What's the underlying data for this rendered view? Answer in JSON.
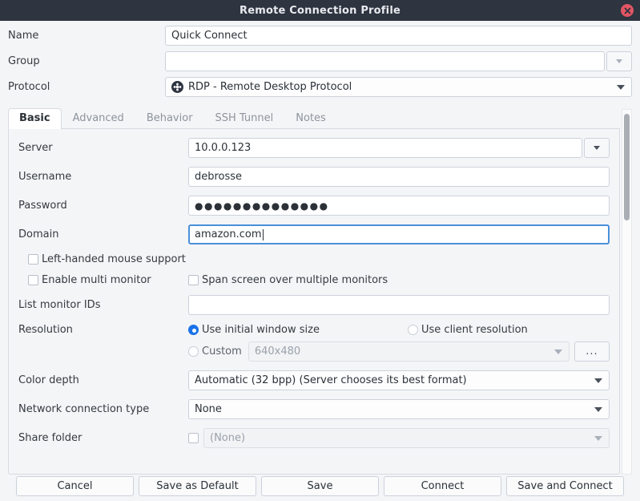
{
  "window": {
    "title": "Remote Connection Profile",
    "close_icon": "close-icon"
  },
  "top_form": {
    "name": {
      "label": "Name",
      "value": "Quick Connect"
    },
    "group": {
      "label": "Group",
      "value": ""
    },
    "protocol": {
      "label": "Protocol",
      "value": "RDP - Remote Desktop Protocol",
      "icon": "rdp-protocol-icon"
    }
  },
  "tabs": [
    {
      "label": "Basic",
      "active": true
    },
    {
      "label": "Advanced",
      "active": false
    },
    {
      "label": "Behavior",
      "active": false
    },
    {
      "label": "SSH Tunnel",
      "active": false
    },
    {
      "label": "Notes",
      "active": false
    }
  ],
  "basic": {
    "server": {
      "label": "Server",
      "value": "10.0.0.123"
    },
    "username": {
      "label": "Username",
      "value": "debrosse"
    },
    "password": {
      "label": "Password",
      "value": "●●●●●●●●●●●●●●"
    },
    "domain": {
      "label": "Domain",
      "value": "amazon.com",
      "focused": true
    },
    "left_handed": {
      "label": "Left-handed mouse support",
      "checked": false
    },
    "multi_monitor": {
      "label": "Enable multi monitor",
      "checked": false
    },
    "span_screen": {
      "label": "Span screen over multiple monitors",
      "checked": false
    },
    "monitor_ids": {
      "label": "List monitor IDs",
      "value": ""
    },
    "resolution": {
      "label": "Resolution",
      "initial": {
        "label": "Use initial window size",
        "selected": true
      },
      "client": {
        "label": "Use client resolution",
        "selected": false
      },
      "custom": {
        "label": "Custom",
        "selected": false,
        "value": "640x480",
        "browse_label": "..."
      }
    },
    "color_depth": {
      "label": "Color depth",
      "value": "Automatic (32 bpp) (Server chooses its best format)"
    },
    "network_type": {
      "label": "Network connection type",
      "value": "None"
    },
    "share_folder": {
      "label": "Share folder",
      "value": "(None)",
      "checked": false
    }
  },
  "buttons": [
    {
      "label": "Cancel"
    },
    {
      "label": "Save as Default"
    },
    {
      "label": "Save"
    },
    {
      "label": "Connect"
    },
    {
      "label": "Save and Connect"
    }
  ],
  "colors": {
    "titlebar": "#2e3440",
    "close": "#e25563",
    "accent": "#1a73e8",
    "focus_border": "#4a90d9",
    "body": "#f4f5f7"
  }
}
